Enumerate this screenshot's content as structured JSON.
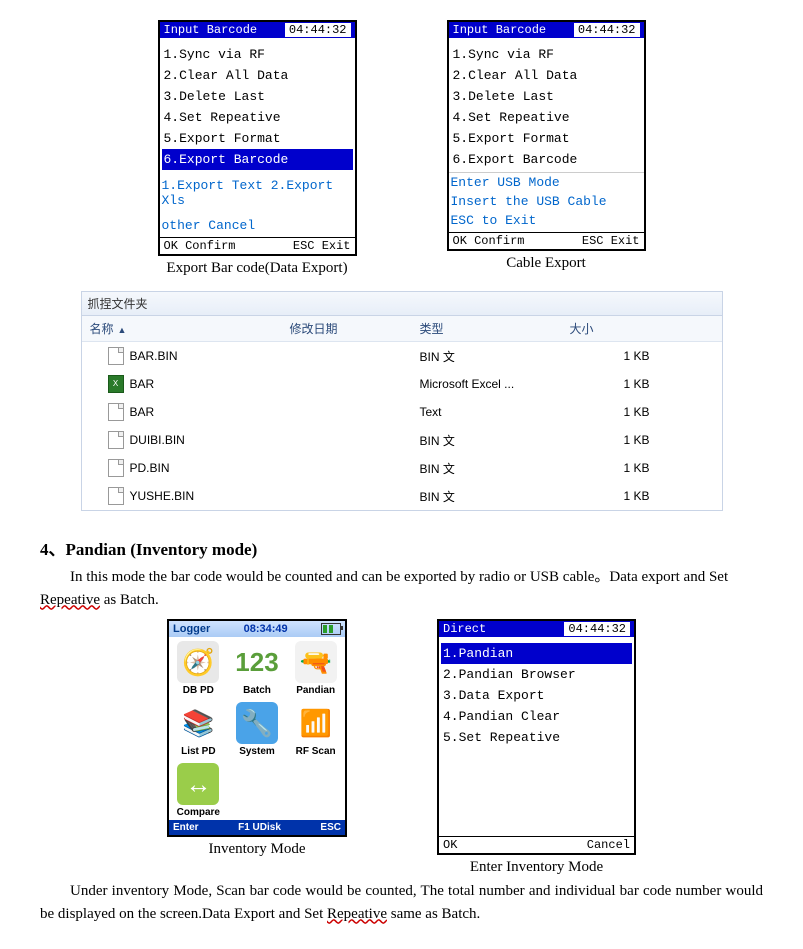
{
  "screen1": {
    "title": "Input Barcode",
    "time": "04:44:32",
    "items": [
      "1.Sync via RF",
      "2.Clear All Data",
      "3.Delete Last",
      "4.Set Repeative",
      "5.Export Format",
      "6.Export Barcode"
    ],
    "selected": 5,
    "sub1": "1.Export Text  2.Export Xls",
    "sub2": "other Cancel",
    "footL": "OK Confirm",
    "footR": "ESC Exit",
    "caption": "Export Bar code(Data Export)"
  },
  "screen2": {
    "title": "Input Barcode",
    "time": "04:44:32",
    "items": [
      "1.Sync via RF",
      "2.Clear All Data",
      "3.Delete Last",
      "4.Set Repeative",
      "5.Export Format",
      "6.Export Barcode"
    ],
    "msg1": "Enter USB Mode",
    "msg2": "Insert the USB Cable",
    "msg3": "ESC to Exit",
    "footL": "OK Confirm",
    "footR": "ESC Exit",
    "caption": "Cable Export"
  },
  "files": {
    "top": "抓捏文件夹",
    "hdr": {
      "name": "名称",
      "date": "修改日期",
      "type": "类型",
      "size": "大小"
    },
    "rows": [
      {
        "name": "BAR.BIN",
        "type": "BIN 文",
        "size": "1 KB",
        "icon": "doc"
      },
      {
        "name": "BAR",
        "type": "Microsoft Excel ...",
        "size": "1 KB",
        "icon": "xls"
      },
      {
        "name": "BAR",
        "type": "Text",
        "size": "1 KB",
        "icon": "doc"
      },
      {
        "name": "DUIBI.BIN",
        "type": "BIN 文",
        "size": "1 KB",
        "icon": "doc"
      },
      {
        "name": "PD.BIN",
        "type": "BIN 文",
        "size": "1 KB",
        "icon": "doc"
      },
      {
        "name": "YUSHE.BIN",
        "type": "BIN 文",
        "size": "1 KB",
        "icon": "doc"
      }
    ]
  },
  "section": {
    "heading_pre": "4、Pandian (Inventory mode)",
    "p1a": "In this mode the bar code would be counted and can be exported by radio or USB cable。Data export and Set ",
    "p1b": "Repeative",
    "p1c": " as Batch.",
    "p2a": "Under inventory Mode, Scan bar code would be counted, The total number and individual bar code number would be displayed on the screen.Data Export and Set ",
    "p2b": "Repeative",
    "p2c": " same as Batch."
  },
  "logger": {
    "title": "Logger",
    "time": "08:34:49",
    "cells": [
      {
        "label": "DB PD",
        "icon": "🧭",
        "bg": "#e8e8e8"
      },
      {
        "label": "Batch",
        "icon": "123",
        "bg": "#fff",
        "color": "#5a9e3a"
      },
      {
        "label": "Pandian",
        "icon": "🔫",
        "bg": "#f2f2f2"
      },
      {
        "label": "List PD",
        "icon": "📚",
        "bg": "#fff"
      },
      {
        "label": "System",
        "icon": "🔧",
        "bg": "#4aa3e8",
        "color": "#fff"
      },
      {
        "label": "RF Scan",
        "icon": "📶",
        "bg": "#fff",
        "color": "#1a7dd4"
      },
      {
        "label": "Compare",
        "icon": "↔",
        "bg": "#9acd4a",
        "color": "#fff"
      }
    ],
    "footL": "Enter",
    "footC": "F1 UDisk",
    "footR": "ESC",
    "caption": "Inventory   Mode"
  },
  "screen3": {
    "title": "Direct",
    "time": "04:44:32",
    "items": [
      "1.Pandian",
      "2.Pandian Browser",
      "3.Data Export",
      "4.Pandian Clear",
      "5.Set Repeative"
    ],
    "selected": 0,
    "footL": "OK",
    "footR": "Cancel",
    "caption": "Enter Inventory Mode"
  }
}
